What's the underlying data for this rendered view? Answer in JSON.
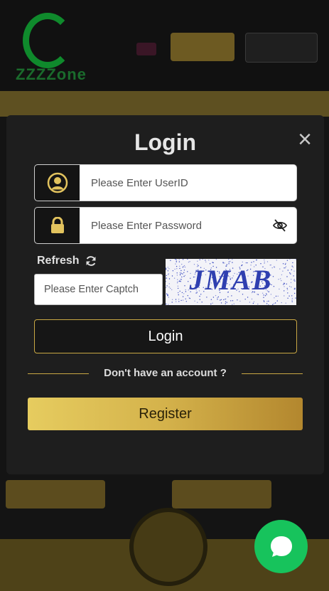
{
  "background": {
    "logo_text": "ZZZZone"
  },
  "modal": {
    "title": "Login",
    "close_icon": "×",
    "userid_placeholder": "Please Enter UserID",
    "password_placeholder": "Please Enter Password",
    "refresh_label": "Refresh",
    "captcha_placeholder": "Please Enter Captch",
    "captcha_text": "JMAB",
    "login_label": "Login",
    "no_account_text": "Don't have an account ?",
    "register_label": "Register"
  },
  "colors": {
    "accent_gold": "#c9a844",
    "modal_bg": "#1e1e1e",
    "chat_green": "#17c35c"
  },
  "icons": {
    "user": "user-circle-icon",
    "lock": "lock-icon",
    "eye": "eye-off-icon",
    "refresh": "refresh-icon",
    "close": "close-icon",
    "chat": "chat-bubble-icon"
  }
}
